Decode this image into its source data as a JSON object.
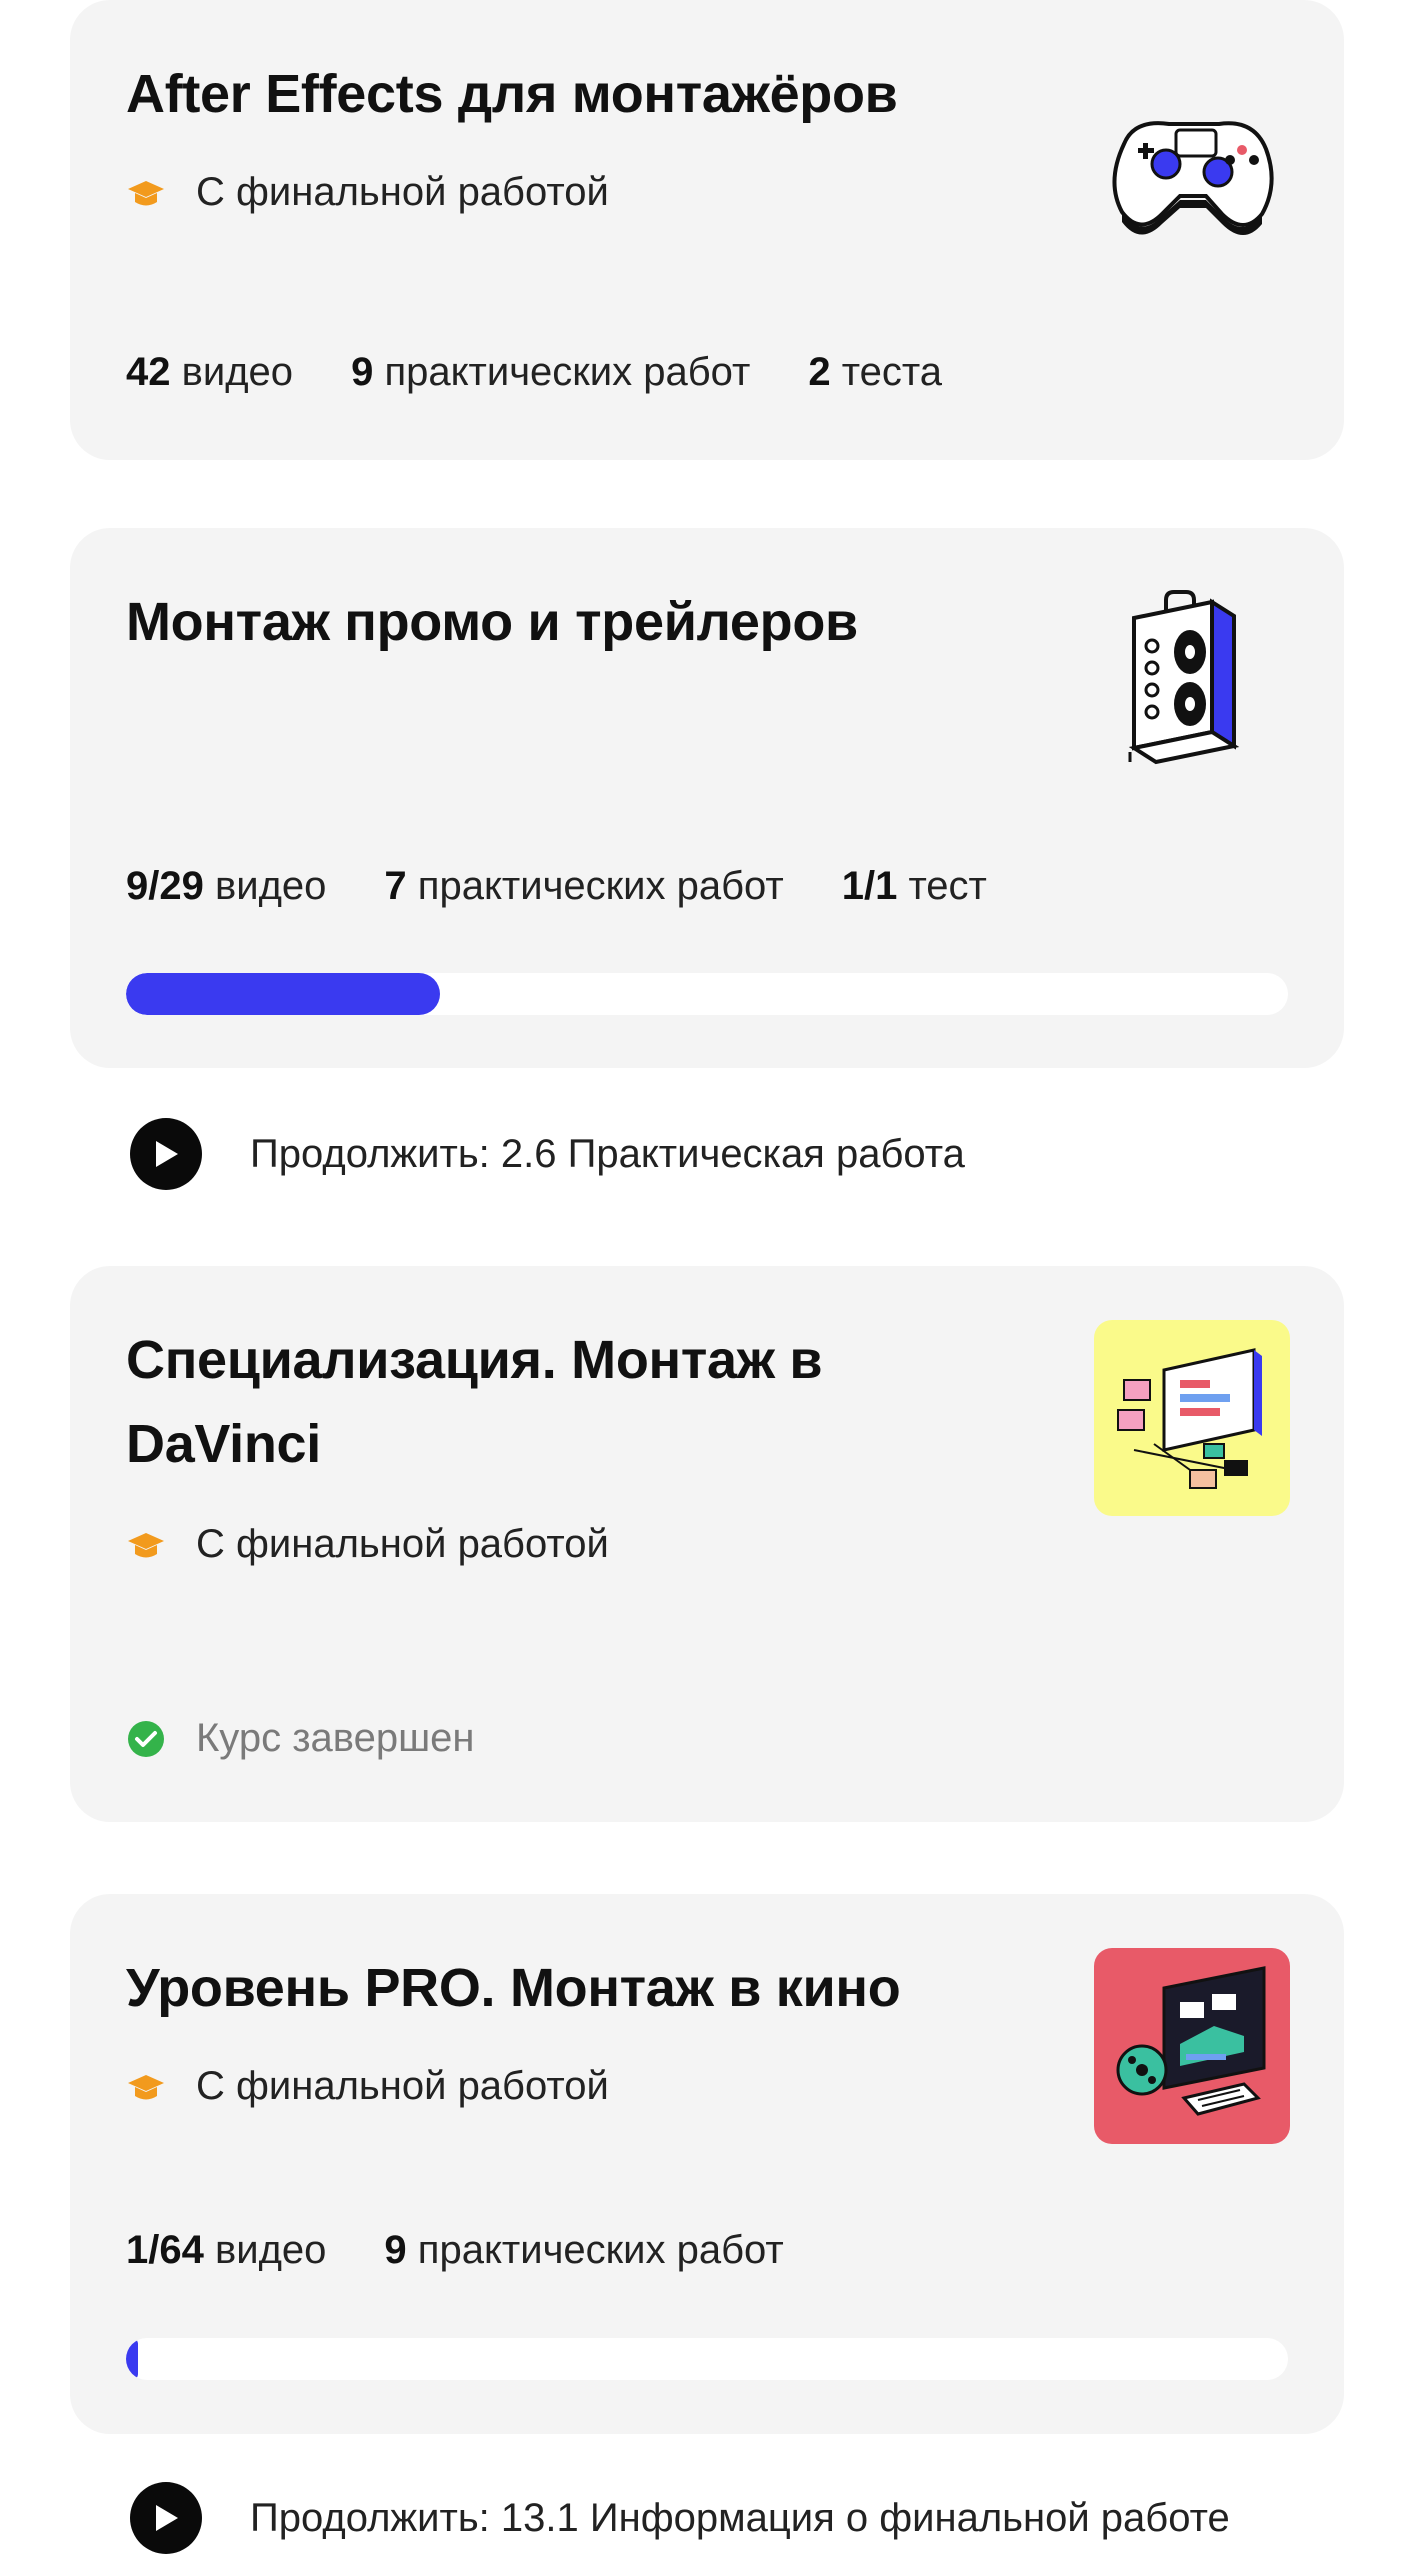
{
  "courses": [
    {
      "title": "After Effects для монтажёров",
      "badge": "С финальной работой",
      "stats": [
        {
          "value": "42",
          "label": "видео"
        },
        {
          "value": "9",
          "label": "практических работ"
        },
        {
          "value": "2",
          "label": "теста"
        }
      ],
      "thumbnail_icon": "gamepad-illustration"
    },
    {
      "title": "Монтаж промо и трейлеров",
      "stats": [
        {
          "value": "9/29",
          "label": "видео"
        },
        {
          "value": "7",
          "label": "практических работ"
        },
        {
          "value": "1/1",
          "label": "тест"
        }
      ],
      "progress_fraction": 0.27,
      "continue_label": "Продолжить: 2.6 Практическая работа",
      "thumbnail_icon": "speaker-illustration"
    },
    {
      "title": "Специализация. Монтаж в DaVinci",
      "badge": "С финальной работой",
      "status": "Курс завершен",
      "thumbnail_icon": "editing-screen-illustration",
      "thumbnail_bg": "#fafa8a"
    },
    {
      "title": "Уровень PRO. Монтаж в кино",
      "badge": "С финальной работой",
      "stats": [
        {
          "value": "1/64",
          "label": "видео"
        },
        {
          "value": "9",
          "label": "практических работ"
        }
      ],
      "progress_fraction": 0.01,
      "continue_label": "Продолжить: 13.1 Информация о финальной работе",
      "thumbnail_icon": "film-editing-illustration",
      "thumbnail_bg": "#e85a68"
    }
  ],
  "colors": {
    "accent": "#3a3af0",
    "card_bg": "#f4f4f4",
    "badge_orange": "#f29a1d",
    "success_green": "#34b34a"
  }
}
